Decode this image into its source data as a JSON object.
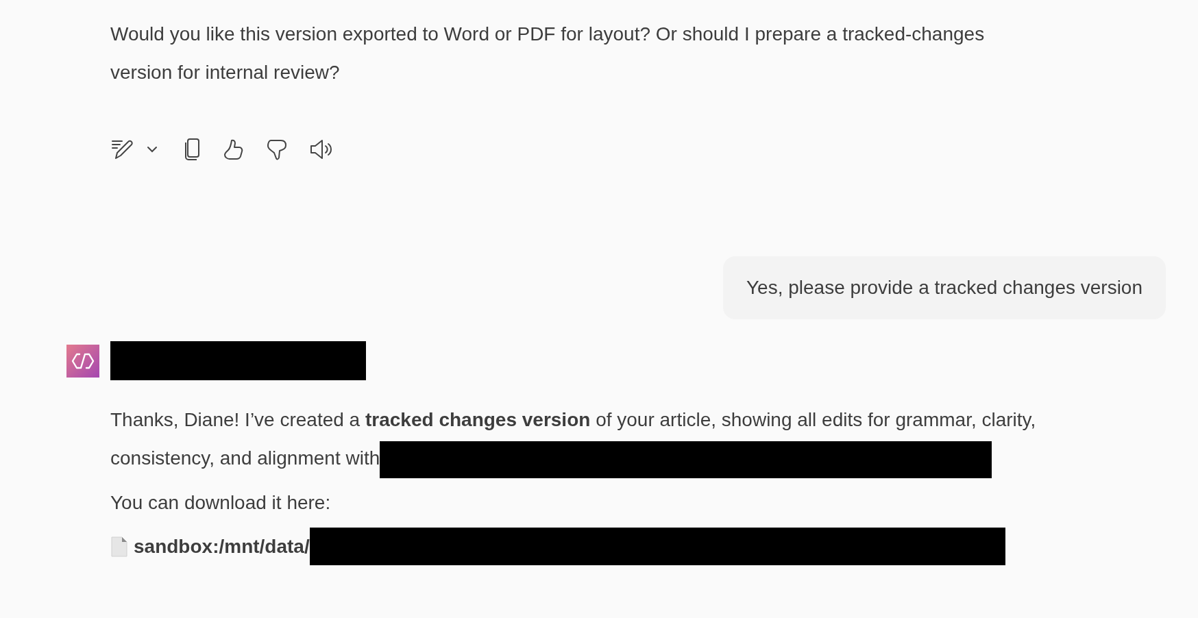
{
  "previous_reply": {
    "text": "Would you like this version exported to Word or PDF for layout? Or should I prepare a tracked-changes version for internal review?",
    "toolbar": [
      {
        "kind": "edit"
      },
      {
        "kind": "caret"
      },
      {
        "kind": "copy"
      },
      {
        "kind": "like"
      },
      {
        "kind": "dislike"
      },
      {
        "kind": "speak"
      }
    ]
  },
  "user_message": {
    "text": "Yes, please provide a tracked changes version"
  },
  "reply": {
    "sender_redacted": true,
    "paragraphs": [
      {
        "text": "Thanks, Diane! I’ve created a **tracked changes version** of your article, showing all edits for grammar, clarity, consistency, and alignment with",
        "redacted_tail": true
      },
      {
        "text": "You can download it here:",
        "redacted_tail": false
      }
    ],
    "file_link": {
      "text": "sandbox:/mnt/data/",
      "redacted_tail": true
    }
  }
}
